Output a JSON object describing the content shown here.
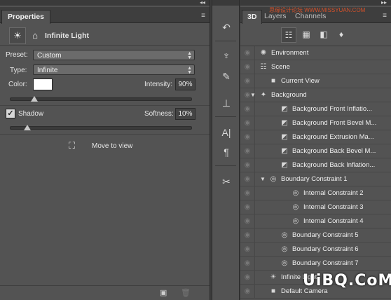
{
  "properties_panel": {
    "tab_label": "Properties",
    "collapse_label": "◂◂",
    "menu_label": "≡",
    "title": "Infinite Light",
    "preset_label": "Preset:",
    "preset_value": "Custom",
    "type_label": "Type:",
    "type_value": "Infinite",
    "color_label": "Color:",
    "color_value": "#ffffff",
    "intensity_label": "Intensity:",
    "intensity_value": "90%",
    "intensity_level": 0.9,
    "shadow_label": "Shadow",
    "shadow_checked": true,
    "softness_label": "Softness:",
    "softness_value": "10%",
    "softness_level": 0.1,
    "move_to_view_label": "Move to view"
  },
  "right_panel": {
    "collapse_label": "▸▸",
    "menu_label": "≡",
    "tabs": [
      {
        "label": "3D",
        "active": true
      },
      {
        "label": "Layers",
        "active": false
      },
      {
        "label": "Channels",
        "active": false
      }
    ],
    "watermark_top": "思缘设计论坛 WWW.MISSYUAN.COM",
    "toolbar_icons": [
      "scene-filter-icon",
      "mesh-filter-icon",
      "material-filter-icon",
      "light-filter-icon"
    ],
    "tree": [
      {
        "label": "Environment",
        "icon": "environment-icon",
        "indent": 0,
        "toggle": ""
      },
      {
        "label": "Scene",
        "icon": "scene-icon",
        "indent": 0,
        "toggle": ""
      },
      {
        "label": "Current View",
        "icon": "camera-icon",
        "indent": 1,
        "toggle": ""
      },
      {
        "label": "Background",
        "icon": "mesh-icon",
        "indent": 0,
        "toggle": "▼"
      },
      {
        "label": "Background Front Inflatio...",
        "icon": "material-icon",
        "indent": 2,
        "toggle": ""
      },
      {
        "label": "Background Front Bevel M...",
        "icon": "material-icon",
        "indent": 2,
        "toggle": ""
      },
      {
        "label": "Background Extrusion Ma...",
        "icon": "material-icon",
        "indent": 2,
        "toggle": ""
      },
      {
        "label": "Background Back Bevel M...",
        "icon": "material-icon",
        "indent": 2,
        "toggle": ""
      },
      {
        "label": "Background Back Inflation...",
        "icon": "material-icon",
        "indent": 2,
        "toggle": ""
      },
      {
        "label": "Boundary Constraint 1",
        "icon": "constraint-icon",
        "indent": 1,
        "toggle": "▼"
      },
      {
        "label": "Internal Constraint 2",
        "icon": "constraint-icon",
        "indent": 3,
        "toggle": ""
      },
      {
        "label": "Internal Constraint 3",
        "icon": "constraint-icon",
        "indent": 3,
        "toggle": ""
      },
      {
        "label": "Internal Constraint 4",
        "icon": "constraint-icon",
        "indent": 3,
        "toggle": ""
      },
      {
        "label": "Boundary Constraint 5",
        "icon": "constraint-icon",
        "indent": 2,
        "toggle": ""
      },
      {
        "label": "Boundary Constraint 6",
        "icon": "constraint-icon",
        "indent": 2,
        "toggle": ""
      },
      {
        "label": "Boundary Constraint 7",
        "icon": "constraint-icon",
        "indent": 2,
        "toggle": ""
      },
      {
        "label": "Infinite Light",
        "icon": "light-icon",
        "indent": 1,
        "toggle": ""
      },
      {
        "label": "Default Camera",
        "icon": "camera-icon",
        "indent": 1,
        "toggle": ""
      }
    ]
  },
  "watermark": "UiBQ.CoM"
}
